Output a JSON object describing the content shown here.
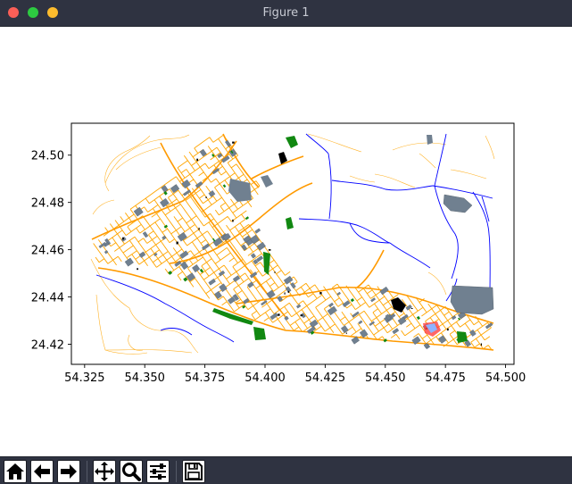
{
  "window": {
    "title": "Figure 1",
    "buttons": [
      "close",
      "minimize",
      "maximize"
    ]
  },
  "plot": {
    "x_ticks": [
      "54.325",
      "54.350",
      "54.375",
      "54.400",
      "54.425",
      "54.450",
      "54.475",
      "54.500"
    ],
    "y_ticks": [
      "24.50",
      "24.48",
      "24.46",
      "24.44",
      "24.42"
    ],
    "xlim": [
      54.3195,
      54.5035
    ],
    "ylim": [
      24.4115,
      24.5135
    ],
    "colors": {
      "streets": "#ffa500",
      "waterways": "#0000ff",
      "buildings": "#708090",
      "parks": "#008000",
      "misc": "#000000"
    }
  },
  "toolbar": {
    "tools": [
      {
        "name": "home",
        "icon": "home-icon"
      },
      {
        "name": "back",
        "icon": "arrow-left-icon"
      },
      {
        "name": "forward",
        "icon": "arrow-right-icon"
      },
      {
        "name": "pan",
        "icon": "move-icon"
      },
      {
        "name": "zoom",
        "icon": "magnifier-icon"
      },
      {
        "name": "configure-subplots",
        "icon": "sliders-icon"
      },
      {
        "name": "save",
        "icon": "floppy-disk-icon"
      }
    ]
  }
}
